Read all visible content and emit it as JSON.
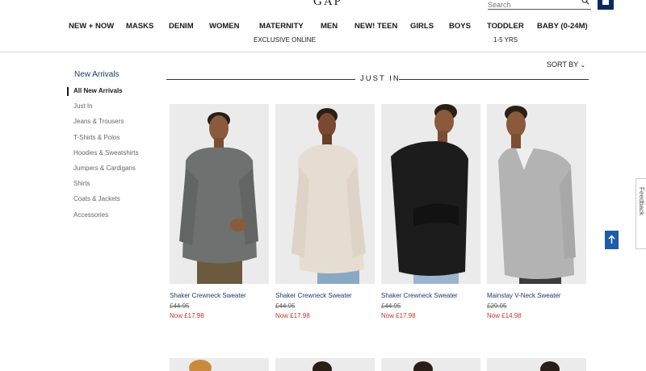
{
  "header": {
    "logo": "GAP",
    "search_placeholder": "Search",
    "nav": [
      {
        "label": "NEW + NOW",
        "sub": ""
      },
      {
        "label": "MASKS",
        "sub": ""
      },
      {
        "label": "DENIM",
        "sub": ""
      },
      {
        "label": "WOMEN",
        "sub": ""
      },
      {
        "label": "MATERNITY",
        "sub": "EXCLUSIVE ONLINE"
      },
      {
        "label": "MEN",
        "sub": ""
      },
      {
        "label": "NEW! TEEN",
        "sub": ""
      },
      {
        "label": "GIRLS",
        "sub": ""
      },
      {
        "label": "BOYS",
        "sub": ""
      },
      {
        "label": "TODDLER",
        "sub": "1-5 YRS"
      },
      {
        "label": "BABY (0-24M)",
        "sub": ""
      }
    ]
  },
  "sidebar": {
    "title": "New Arrivals",
    "items": [
      {
        "label": "All New Arrivals",
        "active": true
      },
      {
        "label": "Just In",
        "active": false
      },
      {
        "label": "Jeans & Trousers",
        "active": false
      },
      {
        "label": "T-Shirts & Polos",
        "active": false
      },
      {
        "label": "Hoodies & Sweatshirts",
        "active": false
      },
      {
        "label": "Jumpers & Cardigans",
        "active": false
      },
      {
        "label": "Shirts",
        "active": false
      },
      {
        "label": "Coats & Jackets",
        "active": false
      },
      {
        "label": "Accessories",
        "active": false
      }
    ]
  },
  "main": {
    "sort_label": "SORT BY",
    "section_heading": "JUST IN",
    "products": [
      {
        "name": "Shaker Crewneck Sweater",
        "was": "£44.95",
        "now": "Now £17.98",
        "sweater_color": "#6f7070",
        "pants_color": "#6b5a3e"
      },
      {
        "name": "Shaker Crewneck Sweater",
        "was": "£44.95",
        "now": "Now £17.98",
        "sweater_color": "#e6ddd2",
        "pants_color": "#8aa8c4"
      },
      {
        "name": "Shaker Crewneck Sweater",
        "was": "£44.95",
        "now": "Now £17.98",
        "sweater_color": "#1c1c1c",
        "pants_color": "#9db4ce"
      },
      {
        "name": "Mainstay V-Neck Sweater",
        "was": "£29.95",
        "now": "Now £14.98",
        "sweater_color": "#b3b3b3",
        "pants_color": "#3c3c3c"
      }
    ]
  },
  "right_rail": {
    "feedback_label": "Feedback"
  },
  "colors": {
    "brand_navy": "#0a2a5e",
    "link_blue": "#1d3a6b",
    "sale_red": "#c0392b",
    "scroll_button": "#1d5ca8"
  }
}
